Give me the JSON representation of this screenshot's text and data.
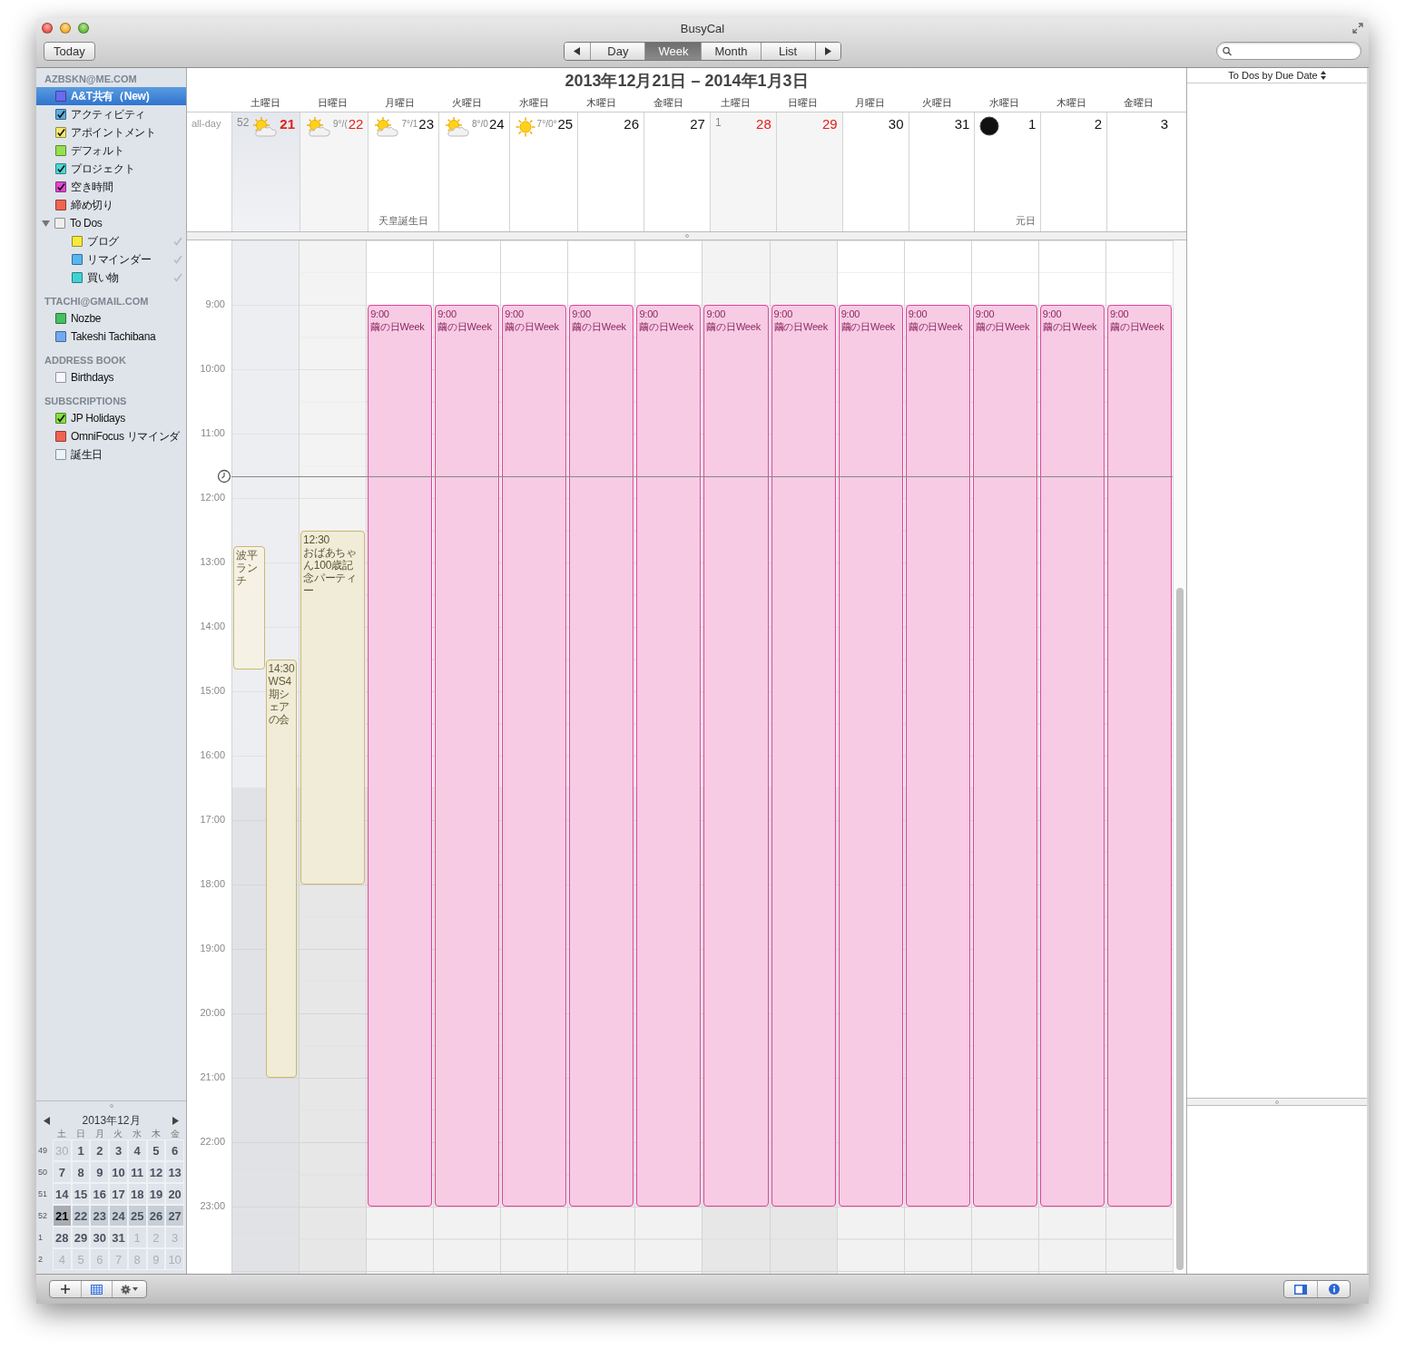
{
  "window": {
    "title": "BusyCal"
  },
  "toolbar": {
    "today": "Today",
    "views": [
      {
        "label": "Day",
        "selected": false
      },
      {
        "label": "Week",
        "selected": true
      },
      {
        "label": "Month",
        "selected": false
      },
      {
        "label": "List",
        "selected": false
      }
    ]
  },
  "sidebar": {
    "groups": [
      {
        "header": "AZBSKN@ME.COM",
        "items": [
          {
            "label": "A&T共有（New)",
            "color": "#6a6af0",
            "checked": false,
            "selected": true
          },
          {
            "label": "アクティビティ",
            "color": "#5aaee0",
            "checked": true,
            "selected": false
          },
          {
            "label": "アポイントメント",
            "color": "#f4e86e",
            "checked": true,
            "selected": false
          },
          {
            "label": "デフォルト",
            "color": "#96e050",
            "checked": false,
            "selected": false
          },
          {
            "label": "プロジェクト",
            "color": "#4cd8d8",
            "checked": true,
            "selected": false
          },
          {
            "label": "空き時間",
            "color": "#e048d0",
            "checked": true,
            "selected": false
          },
          {
            "label": "締め切り",
            "color": "#f06452",
            "checked": false,
            "selected": false
          },
          {
            "label": "To Dos",
            "color": "#eeeeee",
            "checked": false,
            "selected": false,
            "expanded": true,
            "children": [
              {
                "label": "ブログ",
                "color": "#f6ea3c",
                "checked": false,
                "selected": false,
                "done": true
              },
              {
                "label": "リマインダー",
                "color": "#56b6f2",
                "checked": false,
                "selected": false,
                "done": true
              },
              {
                "label": "買い物",
                "color": "#40d2d2",
                "checked": false,
                "selected": false,
                "done": true
              }
            ]
          }
        ]
      },
      {
        "header": "TTACHI@GMAIL.COM",
        "items": [
          {
            "label": "Nozbe",
            "color": "#44c062",
            "checked": false,
            "selected": false
          },
          {
            "label": "Takeshi Tachibana",
            "color": "#72aaf2",
            "checked": false,
            "selected": false
          }
        ]
      },
      {
        "header": "ADDRESS BOOK",
        "items": [
          {
            "label": "Birthdays",
            "color": "#f8f6fe",
            "checked": false,
            "selected": false
          }
        ]
      },
      {
        "header": "SUBSCRIPTIONS",
        "items": [
          {
            "label": "JP Holidays",
            "color": "#84e040",
            "checked": true,
            "selected": false
          },
          {
            "label": "OmniFocus リマインダ",
            "color": "#f06452",
            "checked": false,
            "selected": false
          },
          {
            "label": "誕生日",
            "color": "#eaf2fa",
            "checked": false,
            "selected": false
          }
        ]
      }
    ]
  },
  "mini_month": {
    "title": "2013年12月",
    "weekdays": [
      "土",
      "日",
      "月",
      "火",
      "水",
      "木",
      "金"
    ],
    "weeks": [
      {
        "number": "49",
        "current": false,
        "days": [
          {
            "label": "30",
            "outside": true,
            "selected": false
          },
          {
            "label": "1",
            "outside": false,
            "selected": false
          },
          {
            "label": "2",
            "outside": false,
            "selected": false
          },
          {
            "label": "3",
            "outside": false,
            "selected": false
          },
          {
            "label": "4",
            "outside": false,
            "selected": false
          },
          {
            "label": "5",
            "outside": false,
            "selected": false
          },
          {
            "label": "6",
            "outside": false,
            "selected": false
          }
        ]
      },
      {
        "number": "50",
        "current": false,
        "days": [
          {
            "label": "7",
            "outside": false,
            "selected": false
          },
          {
            "label": "8",
            "outside": false,
            "selected": false
          },
          {
            "label": "9",
            "outside": false,
            "selected": false
          },
          {
            "label": "10",
            "outside": false,
            "selected": false
          },
          {
            "label": "11",
            "outside": false,
            "selected": false
          },
          {
            "label": "12",
            "outside": false,
            "selected": false
          },
          {
            "label": "13",
            "outside": false,
            "selected": false
          }
        ]
      },
      {
        "number": "51",
        "current": false,
        "days": [
          {
            "label": "14",
            "outside": false,
            "selected": false
          },
          {
            "label": "15",
            "outside": false,
            "selected": false
          },
          {
            "label": "16",
            "outside": false,
            "selected": false
          },
          {
            "label": "17",
            "outside": false,
            "selected": false
          },
          {
            "label": "18",
            "outside": false,
            "selected": false
          },
          {
            "label": "19",
            "outside": false,
            "selected": false
          },
          {
            "label": "20",
            "outside": false,
            "selected": false
          }
        ]
      },
      {
        "number": "52",
        "current": true,
        "days": [
          {
            "label": "21",
            "outside": false,
            "selected": true
          },
          {
            "label": "22",
            "outside": false,
            "selected": false
          },
          {
            "label": "23",
            "outside": false,
            "selected": false
          },
          {
            "label": "24",
            "outside": false,
            "selected": false
          },
          {
            "label": "25",
            "outside": false,
            "selected": false
          },
          {
            "label": "26",
            "outside": false,
            "selected": false
          },
          {
            "label": "27",
            "outside": false,
            "selected": false
          }
        ]
      },
      {
        "number": "1",
        "current": false,
        "days": [
          {
            "label": "28",
            "outside": false,
            "selected": false
          },
          {
            "label": "29",
            "outside": false,
            "selected": false
          },
          {
            "label": "30",
            "outside": false,
            "selected": false
          },
          {
            "label": "31",
            "outside": false,
            "selected": false
          },
          {
            "label": "1",
            "outside": true,
            "selected": false
          },
          {
            "label": "2",
            "outside": true,
            "selected": false
          },
          {
            "label": "3",
            "outside": true,
            "selected": false
          }
        ]
      },
      {
        "number": "2",
        "current": false,
        "days": [
          {
            "label": "4",
            "outside": true,
            "selected": false
          },
          {
            "label": "5",
            "outside": true,
            "selected": false
          },
          {
            "label": "6",
            "outside": true,
            "selected": false
          },
          {
            "label": "7",
            "outside": true,
            "selected": false
          },
          {
            "label": "8",
            "outside": true,
            "selected": false
          },
          {
            "label": "9",
            "outside": true,
            "selected": false
          },
          {
            "label": "10",
            "outside": true,
            "selected": false
          }
        ]
      }
    ]
  },
  "calendar": {
    "title": "2013年12月21日 – 2014年1月3日",
    "allday_label": "all-day",
    "hours": [
      "9:00",
      "10:00",
      "11:00",
      "12:00",
      "13:00",
      "14:00",
      "15:00",
      "16:00",
      "17:00",
      "18:00",
      "19:00",
      "20:00",
      "21:00",
      "22:00",
      "23:00"
    ],
    "days": [
      {
        "weekday": "土曜日",
        "date": "21",
        "week": "52",
        "kind": "partly-cloudy",
        "weekend": true,
        "selected": true,
        "events": [
          {
            "title": "波平ランチ",
            "color": "#c8b870"
          },
          {
            "time": "14:30",
            "title": "WS4期シェアの会",
            "color": "#c8b870"
          }
        ]
      },
      {
        "weekday": "日曜日",
        "date": "22",
        "kind": "partly-cloudy",
        "temp": "9°/(",
        "weekend": true,
        "selected": false,
        "events": [
          {
            "time": "12:30",
            "title": "おばあちゃん100歳記念パーティー",
            "color": "#c8b870"
          }
        ]
      },
      {
        "weekday": "月曜日",
        "date": "23",
        "kind": "partly-cloudy",
        "temp": "7°/1",
        "holiday": "天皇誕生日",
        "weekend": false,
        "selected": false,
        "events": [
          {
            "time": "9:00",
            "title": "繭の日Week",
            "color": "#e0409a"
          }
        ]
      },
      {
        "weekday": "火曜日",
        "date": "24",
        "kind": "partly-cloudy",
        "temp": "8°/0",
        "weekend": false,
        "selected": false,
        "events": [
          {
            "time": "9:00",
            "title": "繭の日Week",
            "color": "#e0409a"
          }
        ]
      },
      {
        "weekday": "水曜日",
        "date": "25",
        "kind": "sunny",
        "temp": "7°/0°",
        "weekend": false,
        "selected": false,
        "events": [
          {
            "time": "9:00",
            "title": "繭の日Week",
            "color": "#e0409a"
          }
        ]
      },
      {
        "weekday": "木曜日",
        "date": "26",
        "kind": "plain",
        "weekend": false,
        "selected": false,
        "events": [
          {
            "time": "9:00",
            "title": "繭の日Week",
            "color": "#e0409a"
          }
        ]
      },
      {
        "weekday": "金曜日",
        "date": "27",
        "kind": "plain",
        "weekend": false,
        "selected": false,
        "events": [
          {
            "time": "9:00",
            "title": "繭の日Week",
            "color": "#e0409a"
          }
        ]
      },
      {
        "weekday": "土曜日",
        "date": "28",
        "week": "1",
        "kind": "plain",
        "weekend": true,
        "selected": false,
        "events": [
          {
            "time": "9:00",
            "title": "繭の日Week",
            "color": "#e0409a"
          }
        ]
      },
      {
        "weekday": "日曜日",
        "date": "29",
        "kind": "plain",
        "weekend": true,
        "selected": false,
        "events": [
          {
            "time": "9:00",
            "title": "繭の日Week",
            "color": "#e0409a"
          }
        ]
      },
      {
        "weekday": "月曜日",
        "date": "30",
        "kind": "plain",
        "weekend": false,
        "selected": false,
        "events": [
          {
            "time": "9:00",
            "title": "繭の日Week",
            "color": "#e0409a"
          }
        ]
      },
      {
        "weekday": "火曜日",
        "date": "31",
        "kind": "plain",
        "weekend": false,
        "selected": false,
        "events": [
          {
            "time": "9:00",
            "title": "繭の日Week",
            "color": "#e0409a"
          }
        ]
      },
      {
        "weekday": "水曜日",
        "date": "1",
        "kind": "new-moon",
        "holiday": "元日",
        "weekend": false,
        "selected": false,
        "events": [
          {
            "time": "9:00",
            "title": "繭の日Week",
            "color": "#e0409a"
          }
        ]
      },
      {
        "weekday": "木曜日",
        "date": "2",
        "kind": "plain",
        "weekend": false,
        "selected": false,
        "events": [
          {
            "time": "9:00",
            "title": "繭の日Week",
            "color": "#e0409a"
          }
        ]
      },
      {
        "weekday": "金曜日",
        "date": "3",
        "kind": "plain",
        "weekend": false,
        "selected": false,
        "events": [
          {
            "time": "9:00",
            "title": "繭の日Week",
            "color": "#e0409a"
          }
        ]
      }
    ]
  },
  "todo_panel": {
    "sort_label": "To Dos by Due Date"
  }
}
